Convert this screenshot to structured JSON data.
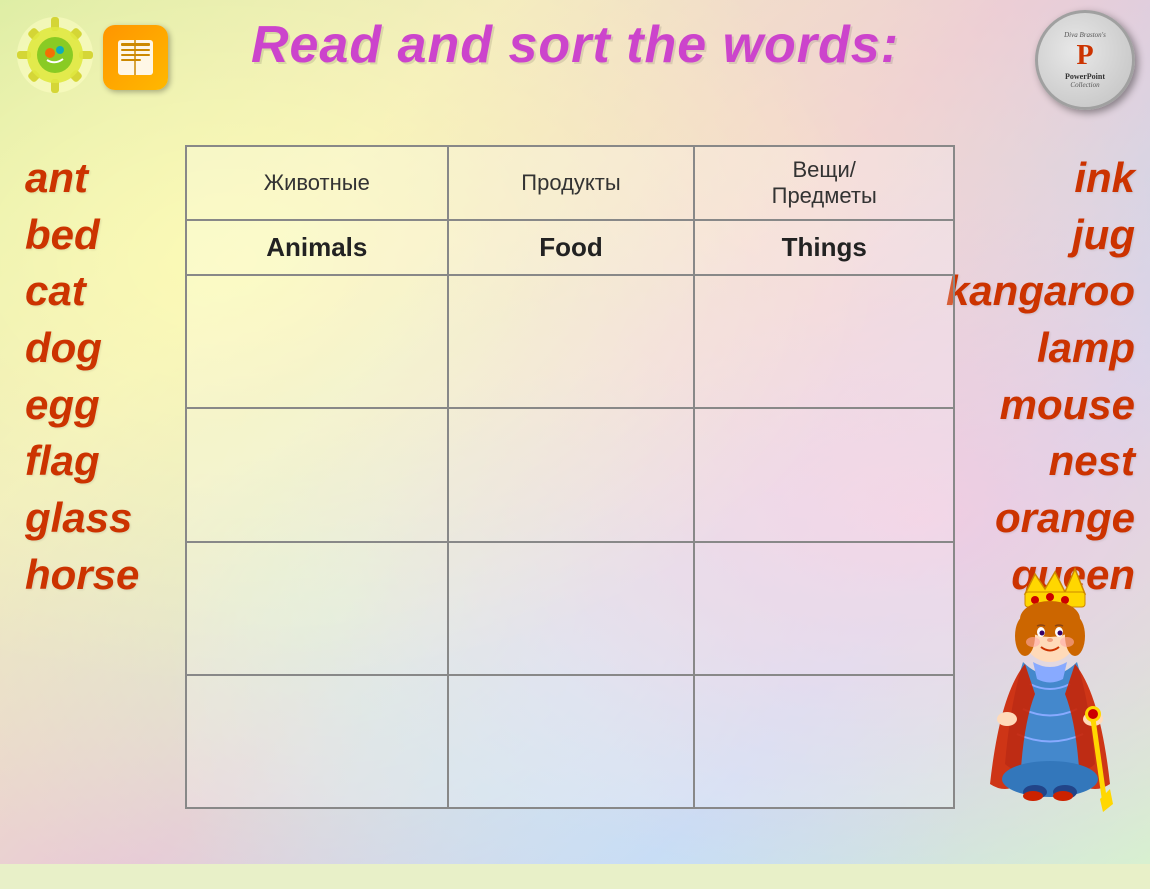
{
  "title": "Read and sort the words:",
  "header_icons": {
    "gear_label": "gear-icon",
    "book_label": "book-icon"
  },
  "ppt": {
    "top_text": "Diva Braston",
    "logo": "P",
    "label": "PowerPoint",
    "sub": "Collection"
  },
  "words_left": [
    "ant",
    "bed",
    "cat",
    "dog",
    "egg",
    "flag",
    "glass",
    "horse"
  ],
  "words_right": [
    "ink",
    "jug",
    "kangaroo",
    "lamp",
    "mouse",
    "nest",
    "orange",
    "queen"
  ],
  "table": {
    "headers_ru": [
      "Животные",
      "Продукты",
      "Вещи/ Предметы"
    ],
    "headers_en": [
      "Animals",
      "Food",
      "Things"
    ],
    "rows": [
      [
        "",
        "",
        ""
      ],
      [
        "",
        "",
        ""
      ],
      [
        "",
        "",
        ""
      ],
      [
        "",
        "",
        ""
      ]
    ]
  }
}
